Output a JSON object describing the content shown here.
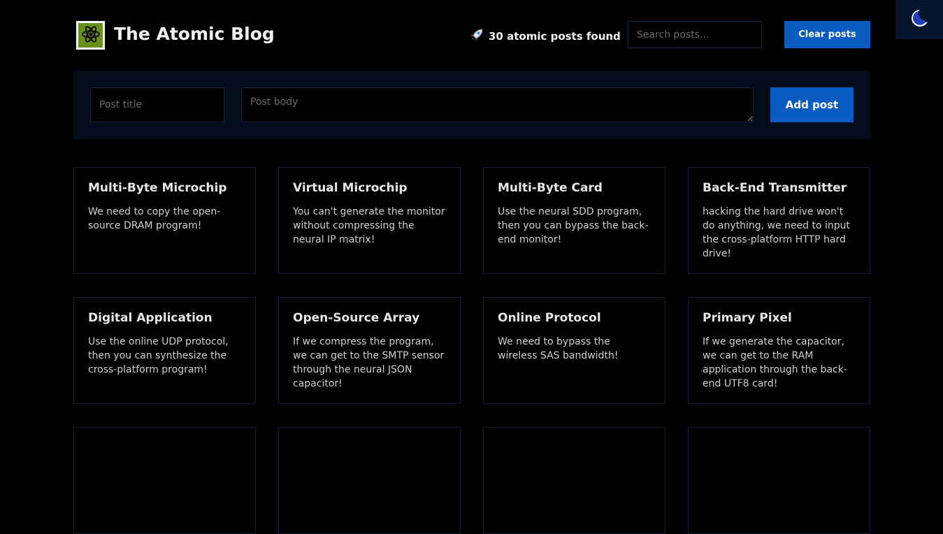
{
  "header": {
    "title": "The Atomic Blog",
    "logo_icon": "atom-icon",
    "posts_found": "30 atomic posts found",
    "rocket_icon": "rocket-icon",
    "search_placeholder": "Search posts...",
    "clear_label": "Clear posts"
  },
  "theme_toggle": {
    "icon": "moon-icon"
  },
  "form": {
    "title_placeholder": "Post title",
    "body_placeholder": "Post body",
    "add_label": "Add post"
  },
  "posts": [
    {
      "title": "Multi-Byte Microchip",
      "body": "We need to copy the open-source DRAM program!"
    },
    {
      "title": "Virtual Microchip",
      "body": "You can't generate the monitor without compressing the neural IP matrix!"
    },
    {
      "title": "Multi-Byte Card",
      "body": "Use the neural SDD program, then you can bypass the back-end monitor!"
    },
    {
      "title": "Back-End Transmitter",
      "body": "hacking the hard drive won't do anything, we need to input the cross-platform HTTP hard drive!"
    },
    {
      "title": "Digital Application",
      "body": "Use the online UDP protocol, then you can synthesize the cross-platform program!"
    },
    {
      "title": "Open-Source Array",
      "body": "If we compress the program, we can get to the SMTP sensor through the neural JSON capacitor!"
    },
    {
      "title": "Online Protocol",
      "body": "We need to bypass the wireless SAS bandwidth!"
    },
    {
      "title": "Primary Pixel",
      "body": "If we generate the capacitor, we can get to the RAM application through the back-end UTF8 card!"
    }
  ],
  "colors": {
    "accent": "#0b5cc0",
    "background": "#000000",
    "panel": "#020c1b",
    "logo_bg": "#6b8f1e"
  }
}
